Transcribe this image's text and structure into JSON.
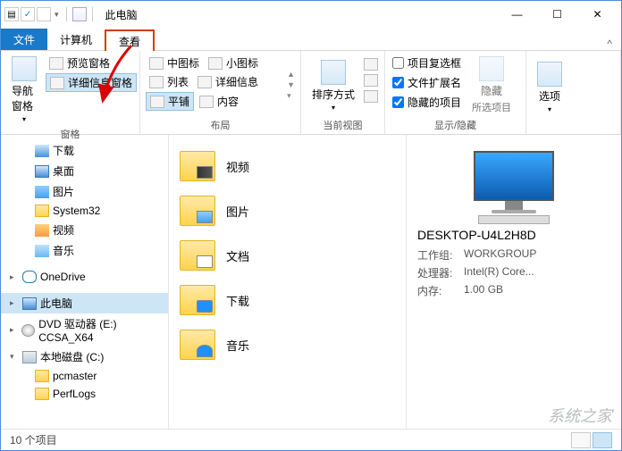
{
  "titlebar": {
    "title": "此电脑",
    "sep": "|"
  },
  "win": {
    "min": "—",
    "max": "☐",
    "close": "✕"
  },
  "tabs": {
    "file": "文件",
    "computer": "计算机",
    "view": "查看",
    "expand": "^"
  },
  "ribbon": {
    "panes": {
      "label": "窗格",
      "nav": "导航窗格",
      "preview": "预览窗格",
      "details": "详细信息窗格"
    },
    "layout": {
      "label": "布局",
      "medium": "中图标",
      "small": "小图标",
      "list": "列表",
      "details": "详细信息",
      "tiles": "平铺",
      "content": "内容"
    },
    "currentview": {
      "label": "当前视图",
      "sort": "排序方式"
    },
    "showhide": {
      "label": "显示/隐藏",
      "checkboxes": "项目复选框",
      "ext": "文件扩展名",
      "hidden": "隐藏的项目",
      "hidebtn": "隐藏",
      "hidebtn2": "所选项目"
    },
    "options": {
      "label": "选项"
    }
  },
  "tree": {
    "downloads": "下载",
    "desktop": "桌面",
    "pictures": "图片",
    "system32": "System32",
    "videos": "视频",
    "music": "音乐",
    "onedrive": "OneDrive",
    "thispc": "此电脑",
    "dvd": "DVD 驱动器 (E:) CCSA_X64",
    "localdisk": "本地磁盘 (C:)",
    "pcmaster": "pcmaster",
    "perflogs": "PerfLogs"
  },
  "main": {
    "videos": "视频",
    "pictures": "图片",
    "documents": "文档",
    "downloads": "下载",
    "music": "音乐"
  },
  "details": {
    "name": "DESKTOP-U4L2H8D",
    "rows": [
      {
        "k": "工作组:",
        "v": "WORKGROUP"
      },
      {
        "k": "处理器:",
        "v": "Intel(R) Core..."
      },
      {
        "k": "内存:",
        "v": "1.00 GB"
      }
    ]
  },
  "status": {
    "count": "10 个项目"
  },
  "watermark": "系统之家"
}
